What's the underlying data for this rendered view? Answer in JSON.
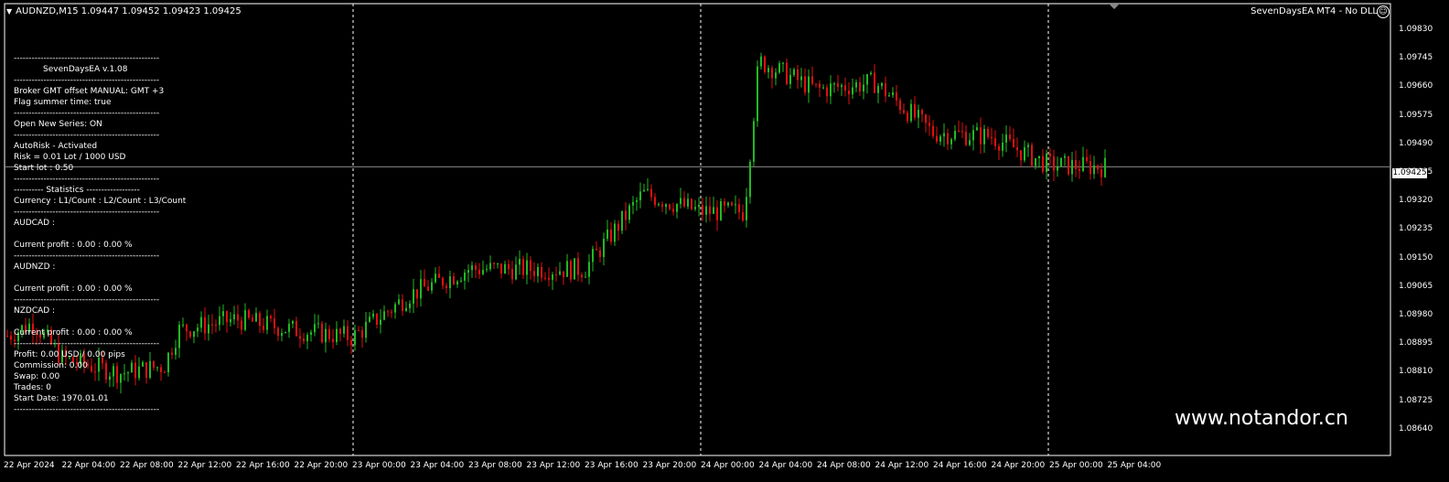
{
  "header": {
    "symbol_info": "AUDNZD,M15  1.09447 1.09452 1.09423 1.09425",
    "ea_status": "SevenDaysEA MT4 - No DLL"
  },
  "ea_panel": {
    "lines": [
      "-------------------------------------------------",
      "SevenDaysEA  v.1.08",
      "-------------------------------------------------",
      "Broker GMT offset MANUAL:  GMT +3",
      "Flag summer time: true",
      "-------------------------------------------------",
      "Open New Series: ON",
      "-------------------------------------------------",
      "AutoRisk - Activated",
      "Risk = 0.01 Lot / 1000 USD",
      "Start lot : 0.50",
      "-------------------------------------------------",
      "----------     Statistics    ------------------",
      "Currency : L1/Count : L2/Count : L3/Count",
      "-------------------------------------------------",
      "AUDCAD :",
      "",
      "Current profit : 0.00 : 0.00 %",
      "-------------------------------------------------",
      "AUDNZD :",
      "",
      "Current profit : 0.00 : 0.00 %",
      "-------------------------------------------------",
      "NZDCAD :",
      "",
      "Current profit : 0.00 : 0.00 %",
      "-------------------------------------------------",
      "Profit: 0.00 USD / 0.00 pips",
      "Commission: 0.00",
      "Swap: 0.00",
      "Trades: 0",
      "Start Date: 1970.01.01",
      "-------------------------------------------------"
    ]
  },
  "price_axis": [
    "1.09830",
    "1.09745",
    "1.09660",
    "1.09575",
    "1.09490",
    "1.09405",
    "1.09320",
    "1.09235",
    "1.09150",
    "1.09065",
    "1.08980",
    "1.08895",
    "1.08810",
    "1.08725",
    "1.08640"
  ],
  "current_price": "1.09425",
  "time_axis": [
    "22 Apr 2024",
    "22 Apr 04:00",
    "22 Apr 08:00",
    "22 Apr 12:00",
    "22 Apr 16:00",
    "22 Apr 20:00",
    "23 Apr 00:00",
    "23 Apr 04:00",
    "23 Apr 08:00",
    "23 Apr 12:00",
    "23 Apr 16:00",
    "23 Apr 20:00",
    "24 Apr 00:00",
    "24 Apr 04:00",
    "24 Apr 08:00",
    "24 Apr 12:00",
    "24 Apr 16:00",
    "24 Apr 20:00",
    "25 Apr 00:00",
    "25 Apr 04:00"
  ],
  "watermark": "www.notandor.cn",
  "colors": {
    "bull": "#22b922",
    "bear": "#e01010",
    "background": "#000000",
    "grid": "#ffffff"
  },
  "chart_data": {
    "type": "candlestick",
    "symbol": "AUDNZD",
    "timeframe": "M15",
    "ylim": [
      1.0862,
      1.0988
    ],
    "close_path": [
      [
        "22 Apr 00:00",
        1.0895
      ],
      [
        "22 Apr 02:00",
        1.0899
      ],
      [
        "22 Apr 04:00",
        1.0889
      ],
      [
        "22 Apr 08:00",
        1.0885
      ],
      [
        "22 Apr 11:00",
        1.0887
      ],
      [
        "22 Apr 12:00",
        1.0897
      ],
      [
        "22 Apr 16:00",
        1.09
      ],
      [
        "22 Apr 20:00",
        1.0897
      ],
      [
        "23 Apr 00:00",
        1.0895
      ],
      [
        "23 Apr 04:00",
        1.0907
      ],
      [
        "23 Apr 08:00",
        1.0914
      ],
      [
        "23 Apr 12:00",
        1.0914
      ],
      [
        "23 Apr 16:00",
        1.0914
      ],
      [
        "23 Apr 20:00",
        1.0935
      ],
      [
        "24 Apr 00:00",
        1.093
      ],
      [
        "24 Apr 03:00",
        1.093
      ],
      [
        "24 Apr 04:00",
        1.0972
      ],
      [
        "24 Apr 08:00",
        1.0964
      ],
      [
        "24 Apr 12:00",
        1.0966
      ],
      [
        "24 Apr 16:00",
        1.0952
      ],
      [
        "24 Apr 20:00",
        1.0951
      ],
      [
        "25 Apr 00:00",
        1.0943
      ],
      [
        "25 Apr 04:00",
        1.09425
      ]
    ]
  }
}
